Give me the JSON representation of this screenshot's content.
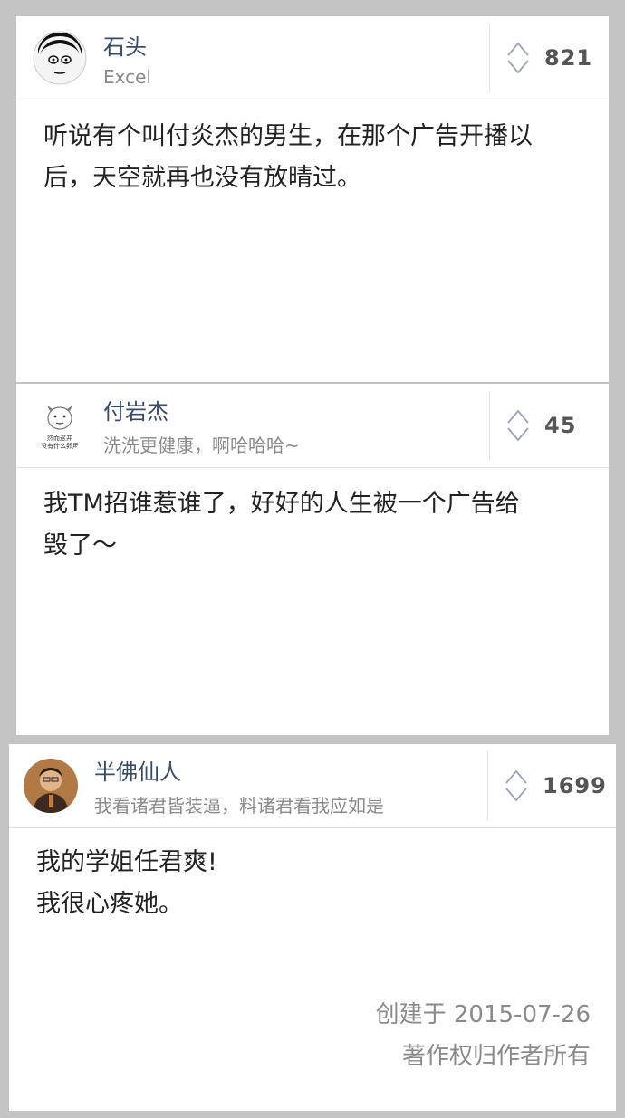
{
  "answers": [
    {
      "username": "石头",
      "signature": "Excel",
      "votes": "821",
      "text_lines": [
        "听说有个叫付炎杰的男生，在那个广告开播以",
        "后，天空就再也没有放晴过。"
      ]
    },
    {
      "username": "付岩杰",
      "signature": "洗洗更健康，啊哈哈哈~",
      "votes": "45",
      "avatar_caption": [
        "然而这并",
        "没有什么卵用"
      ],
      "text_lines": [
        "我TM招谁惹谁了，好好的人生被一个广告给",
        "毁了～"
      ]
    },
    {
      "username": "半佛仙人",
      "signature": "我看诸君皆装逼，料诸君看我应如是",
      "votes": "1699",
      "text_lines": [
        "我的学姐任君爽!",
        "我很心疼她。"
      ]
    }
  ],
  "footer": {
    "created": "创建于 2015-07-26",
    "copyright": "著作权归作者所有"
  },
  "colors": {
    "background": "#c4c4c4",
    "name": "#3a4a66",
    "muted": "#8a8a8a"
  }
}
